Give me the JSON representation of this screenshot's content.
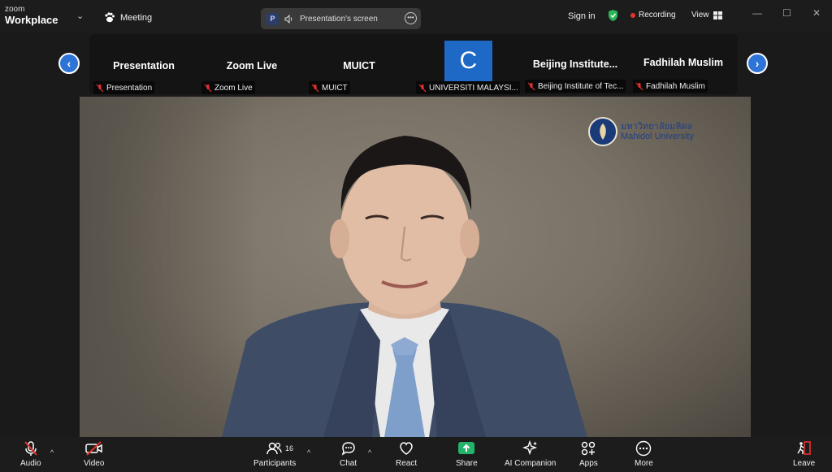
{
  "app": {
    "brand_small": "zoom",
    "brand_big": "Workplace",
    "meeting_label": "Meeting"
  },
  "topbar": {
    "screen_pill_badge": "P",
    "screen_pill_label": "Presentation's screen",
    "signin": "Sign in",
    "recording": "Recording",
    "view": "View"
  },
  "participants": [
    {
      "name": "Presentation",
      "label": "Presentation"
    },
    {
      "name": "Zoom Live",
      "label": "Zoom Live"
    },
    {
      "name": "MUICT",
      "label": "MUICT"
    },
    {
      "name": "",
      "avatar": "C",
      "label": "UNIVERSITI MALAYSI..."
    },
    {
      "name": "Beijing  Institute...",
      "label": "Beijing Institute of Tec..."
    },
    {
      "name": "Fadhilah Muslim",
      "label": "Fadhilah Muslim"
    }
  ],
  "video": {
    "logo_th": "มหาวิทยาลัยมหิดล",
    "logo_en": "Mahidol University"
  },
  "toolbar": {
    "audio": "Audio",
    "video": "Video",
    "participants": "Participants",
    "participants_count": "16",
    "chat": "Chat",
    "react": "React",
    "share": "Share",
    "ai_companion": "AI Companion",
    "apps": "Apps",
    "more": "More",
    "leave": "Leave"
  },
  "colors": {
    "accent": "#2d74d6",
    "share_green": "#23b36b",
    "recording_red": "#e5322d",
    "shield_green": "#2cb55a",
    "avatar_blue": "#1e68c6"
  }
}
